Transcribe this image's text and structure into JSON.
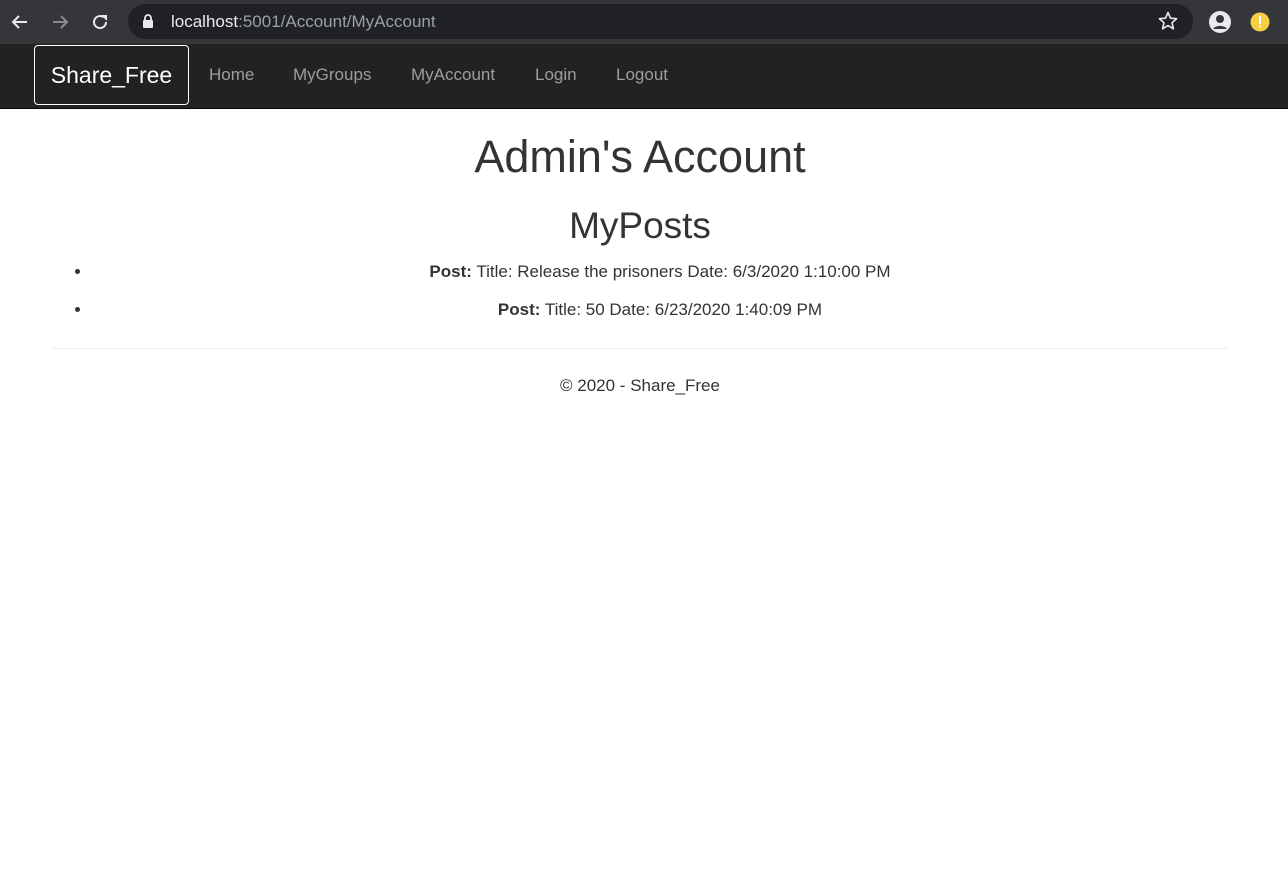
{
  "browser": {
    "url_host": "localhost",
    "url_path": ":5001/Account/MyAccount",
    "icons": [
      "back-arrow-icon",
      "forward-arrow-icon",
      "reload-icon",
      "lock-icon",
      "star-icon",
      "profile-icon",
      "update-alert-icon"
    ],
    "alert_color": "#f9ce45"
  },
  "navbar": {
    "brand": "Share_Free",
    "links": [
      {
        "label": "Home"
      },
      {
        "label": "MyGroups"
      },
      {
        "label": "MyAccount"
      },
      {
        "label": "Login"
      },
      {
        "label": "Logout"
      }
    ],
    "background": "#222222"
  },
  "main": {
    "title": "Admin's Account",
    "section_title": "MyPosts",
    "posts": [
      {
        "prefix": "Post:",
        "text": "Title: Release the prisoners Date: 6/3/2020 1:10:00 PM"
      },
      {
        "prefix": "Post:",
        "text": "Title: 50 Date: 6/23/2020 1:40:09 PM"
      }
    ]
  },
  "footer": {
    "text": "© 2020 - Share_Free"
  }
}
